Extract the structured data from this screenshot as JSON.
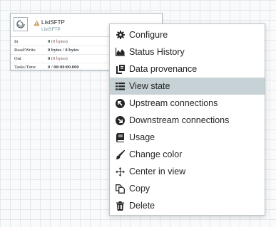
{
  "processor": {
    "name": "ListSFTP",
    "type": "ListSFTP",
    "stats": [
      {
        "label": "In",
        "main": "0",
        "sub": "(0 bytes)"
      },
      {
        "label": "Read/Write",
        "main": "0 bytes / 0 bytes",
        "sub": ""
      },
      {
        "label": "Out",
        "main": "0",
        "sub": "(0 bytes)"
      },
      {
        "label": "Tasks/Time",
        "main": "0 / 00:00:00.000",
        "sub": ""
      }
    ]
  },
  "menu": {
    "items": [
      {
        "label": "Configure",
        "icon": "gear-icon"
      },
      {
        "label": "Status History",
        "icon": "area-chart-icon"
      },
      {
        "label": "Data provenance",
        "icon": "provenance-icon"
      },
      {
        "label": "View state",
        "icon": "list-icon",
        "highlighted": true
      },
      {
        "label": "Upstream connections",
        "icon": "arrow-circle-icon"
      },
      {
        "label": "Downstream connections",
        "icon": "arrow-circle-icon"
      },
      {
        "label": "Usage",
        "icon": "book-icon"
      },
      {
        "label": "Change color",
        "icon": "paintbrush-icon"
      },
      {
        "label": "Center in view",
        "icon": "crosshairs-icon"
      },
      {
        "label": "Copy",
        "icon": "copy-icon"
      },
      {
        "label": "Delete",
        "icon": "trash-icon"
      }
    ]
  },
  "colors": {
    "canvas": "#f9fafb",
    "menu_highlight": "#c7d2d7",
    "warning": "#cf9f5d",
    "stat_value": "#775351"
  }
}
